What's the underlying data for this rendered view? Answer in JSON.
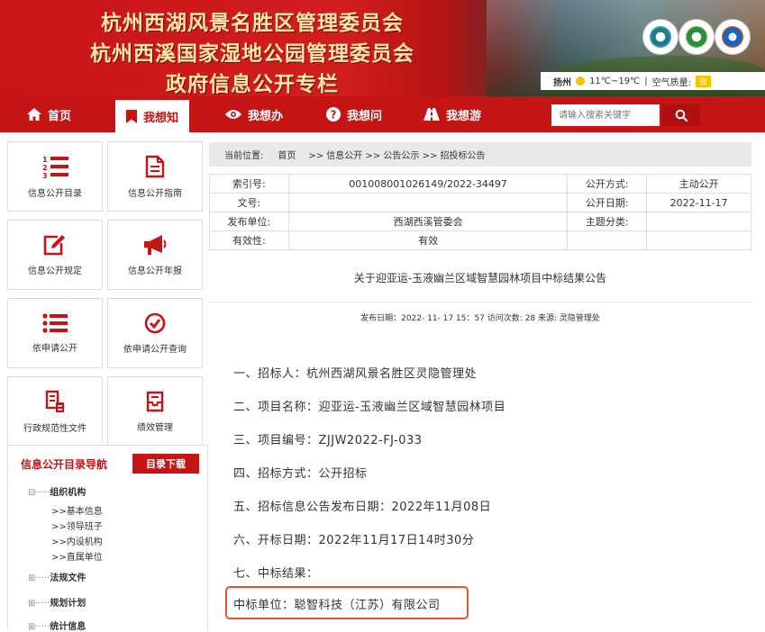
{
  "banner": {
    "lines": [
      "杭州西湖风景名胜区管理委员会",
      "杭州西溪国家湿地公园管理委员会",
      "政府信息公开专栏"
    ],
    "weather": {
      "city": "扬州",
      "temp": "11℃~19℃",
      "separator": "|",
      "aq_label": "空气质量:",
      "aq_value": "良"
    }
  },
  "nav": {
    "items": [
      {
        "label": "首页",
        "icon": "home-icon"
      },
      {
        "label": "我想知",
        "icon": "bookmark-icon"
      },
      {
        "label": "我想办",
        "icon": "eye-icon"
      },
      {
        "label": "我想问",
        "icon": "question-icon"
      },
      {
        "label": "我想游",
        "icon": "road-icon"
      }
    ],
    "search_placeholder": "请输入搜索关键字"
  },
  "sidebar": {
    "tiles": [
      {
        "label": "信息公开目录",
        "icon": "numbered-list-icon"
      },
      {
        "label": "信息公开指南",
        "icon": "document-icon"
      },
      {
        "label": "信息公开规定",
        "icon": "edit-icon"
      },
      {
        "label": "信息公开年报",
        "icon": "megaphone-icon"
      },
      {
        "label": "依申请公开",
        "icon": "list-icon"
      },
      {
        "label": "依申请公开查询",
        "icon": "check-circle-icon"
      },
      {
        "label": "行政规范性文件",
        "icon": "file-stamp-icon"
      },
      {
        "label": "绩效管理",
        "icon": "inbox-icon"
      }
    ],
    "catalog": {
      "title": "信息公开目录导航",
      "download": "目录下载",
      "tree": [
        {
          "label": "组织机构",
          "children": [
            "基本信息",
            "领导班子",
            "内设机构",
            "直属单位"
          ]
        },
        {
          "label": "法规文件"
        },
        {
          "label": "规划计划"
        },
        {
          "label": "统计信息"
        }
      ],
      "prefix": "⊟·····",
      "prefix_collapsed": "⊞·····",
      "child_prefix": ">>"
    }
  },
  "breadcrumb": {
    "label": "当前位置:",
    "home": "首页",
    "path": ">> 信息公开 >> 公告公示 >> 招投标公告"
  },
  "meta": {
    "index_label": "索引号:",
    "index_value": "001008001026149/2022-34497",
    "method_label": "公开方式:",
    "method_value": "主动公开",
    "docno_label": "文号:",
    "docno_value": "",
    "date_label": "公开日期:",
    "date_value": "2022-11-17",
    "org_label": "发布单位:",
    "org_value": "西湖西溪管委会",
    "topic_label": "主题分类:",
    "topic_value": "",
    "valid_label": "有效性:",
    "valid_value": "有效"
  },
  "article": {
    "title": "关于迎亚运-玉液幽兰区域智慧园林项目中标结果公告",
    "pubinfo": "发布日期：2022- 11- 17 15：57 访问次数: 28 来源: 灵隐管理处",
    "paragraphs": [
      "一、招标人：杭州西湖风景名胜区灵隐管理处",
      "二、项目名称：迎亚运-玉液幽兰区域智慧园林项目",
      "三、项目编号：ZJJW2022-FJ-033",
      "四、招标方式：公开招标",
      "五、招标信息公告发布日期：2022年11月08日",
      "六、开标日期：2022年11月17日14时30分",
      "七、中标结果：",
      "中标单位：聪智科技（江苏）有限公司"
    ]
  },
  "colors": {
    "brand_red": "#c41414",
    "highlight": "#e8552e"
  }
}
